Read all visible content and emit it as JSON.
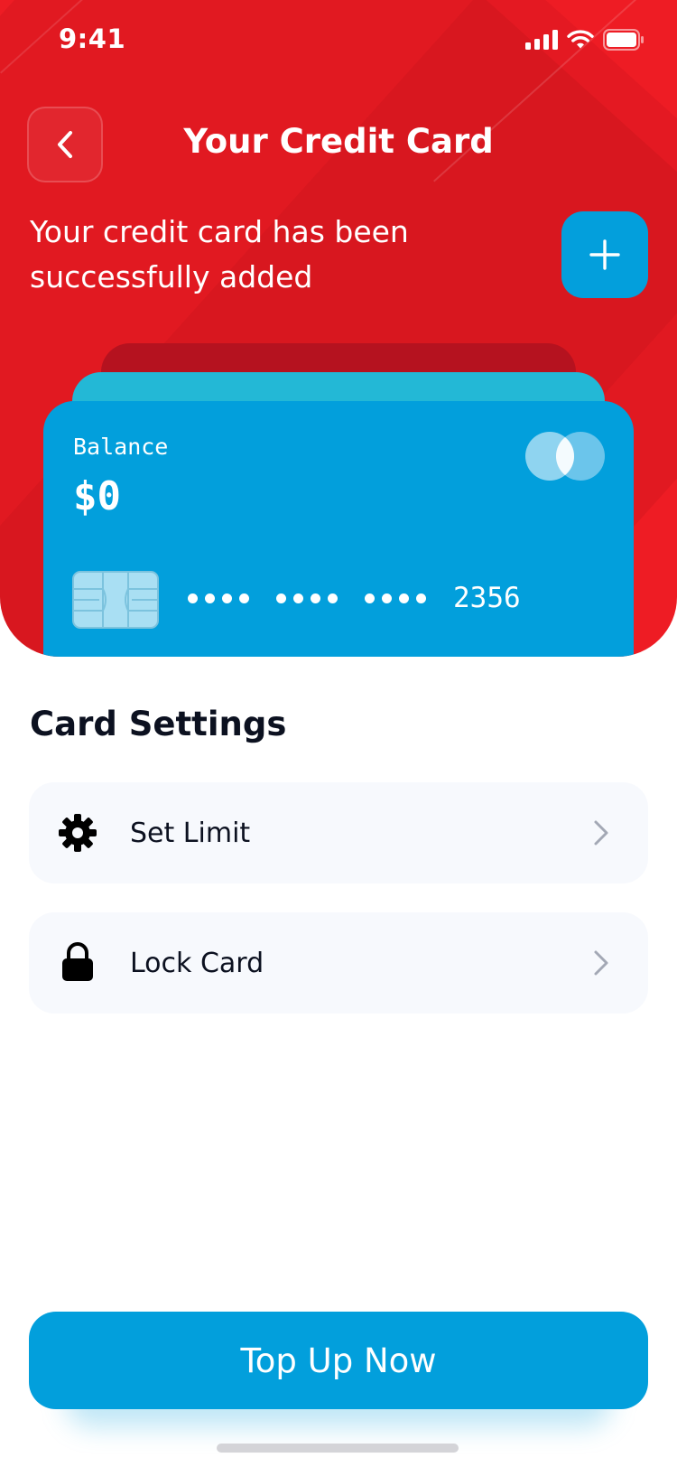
{
  "status_bar": {
    "time": "9:41"
  },
  "header": {
    "title": "Your Credit Card",
    "message": "Your credit card has been successfully added"
  },
  "card": {
    "balance_label": "Balance",
    "balance_value": "$0",
    "last_four": "2356"
  },
  "settings": {
    "title": "Card Settings",
    "items": [
      {
        "label": "Set Limit",
        "icon": "gear-icon"
      },
      {
        "label": "Lock Card",
        "icon": "lock-icon"
      }
    ]
  },
  "actions": {
    "top_up_label": "Top Up Now"
  },
  "colors": {
    "header_red": "#ee1c24",
    "accent_blue": "#029fdc",
    "card_teal": "#23b8d6",
    "card_dark_red": "#b5121f",
    "text_dark": "#0c1120",
    "row_bg": "#f7f9fd"
  }
}
